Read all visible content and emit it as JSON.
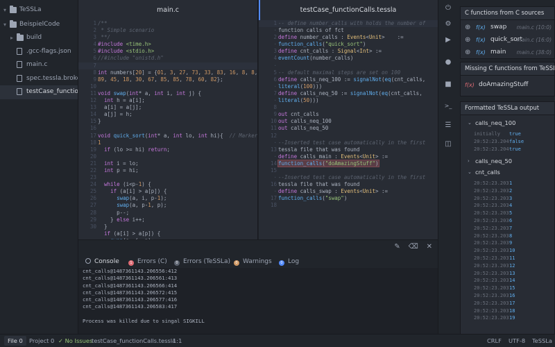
{
  "tree": {
    "root": "TeSSLa",
    "project": "BeispielCode",
    "items": [
      {
        "label": "build",
        "kind": "folder"
      },
      {
        "label": ".gcc-flags.json",
        "kind": "file"
      },
      {
        "label": "main.c",
        "kind": "file"
      },
      {
        "label": "spec.tessla.broken",
        "kind": "file"
      },
      {
        "label": "testCase_functionCalls.tessla",
        "kind": "file",
        "selected": true
      }
    ]
  },
  "editor_left": {
    "tab": "main.c",
    "line_numbers": [
      "1",
      "2",
      "3",
      "4",
      "5",
      "6",
      "7",
      "8",
      "9",
      "10",
      "11",
      "12",
      "13",
      "14",
      "15",
      "16",
      "17",
      "18",
      "19",
      "20",
      "21",
      "22",
      "23",
      "24",
      "25",
      "26",
      "27",
      "28",
      "29",
      "30"
    ],
    "lines": [
      "/**",
      " * Simple scenario",
      " **/",
      "#include <time.h>",
      "#include <stdio.h>",
      "//#include \"unistd.h\"",
      "",
      "int numbers[20] = {01, 3, 27, 73, 33, 83, 16, 8, 8,",
      "89, 45, 18, 30, 67, 85, 85, 78, 60, 82};",
      "",
      "void swap(int* a, int i, int j) {",
      "  int h = a[i];",
      "  a[i] = a[j];",
      "  a[j] = h;",
      "}",
      "",
      "void quick_sort(int* a, int lo, int hi){  // Marker",
      "1",
      "  if (lo >= hi) return;",
      "",
      "  int i = lo;",
      "  int p = hi;",
      "",
      "  while (i<p-1) {",
      "    if (a[i] > a[p]) {",
      "      swap(a, i, p-1);",
      "      swap(a, p-1, p);",
      "      p--;",
      "    } else i++;",
      "  }",
      "  if (a[i] > a[p]) {",
      "    swap(a, i, p);"
    ]
  },
  "editor_right": {
    "tab": "testCase_functionCalls.tessla",
    "line_numbers": [
      "1",
      "·",
      "2",
      "·",
      "3",
      "4",
      "·",
      "5",
      "6",
      "·",
      "7",
      "·",
      "8",
      "9",
      "10",
      "11",
      "12",
      "·",
      "13",
      "·",
      "14",
      "15",
      "·",
      "16",
      "·",
      "17",
      "18"
    ],
    "lines": [
      "-- define number_calls with holds the number of",
      "function calls of fct",
      "define number_calls : Events<Unit>    :=",
      "function_calls(\"quick_sort\")",
      "define cnt_calls : Signal<Int> :=",
      "eventCount(number_calls)",
      "",
      "-- default maximal steps are set on 100",
      "define calls_neq_100 := signalNot(eq(cnt_calls,",
      "literal(100)))",
      "define calls_neq_50 := signalNot(eq(cnt_calls,",
      "literal(50)))",
      "",
      "out cnt_calls",
      "out calls_neq_100",
      "out calls_neq_50",
      "",
      "--Inserted test case automatically in the first",
      "tessla file that was found",
      "define calls_main : Events<Unit> :=",
      "function_calls(\"doAmazingStuff\")",
      "",
      "--Inserted test case automatically in the first",
      "tessla file that was found",
      "define calls_swap : Events<Unit> :=",
      "function_calls(\"swap\")",
      ""
    ]
  },
  "console": {
    "tabs": [
      {
        "label": "Console",
        "badge": ""
      },
      {
        "label": "Errors (C)",
        "badge": "1"
      },
      {
        "label": "Errors (TeSSLa)",
        "badge": "0"
      },
      {
        "label": "Warnings",
        "badge": "0"
      },
      {
        "label": "Log",
        "badge": "0"
      }
    ],
    "output": "cnt_calls@1487361143.206556:412\ncnt_calls@1487361143.206561:413\ncnt_calls@1487361143.206566:414\ncnt_calls@1487361143.206572:415\ncnt_calls@1487361143.206577:416\ncnt_calls@1487361143.206583:417\n\nProcess was killed due to singal SIGKILL"
  },
  "right_panel": {
    "c_functions": {
      "title": "C functions from C sources",
      "items": [
        {
          "fx": "f(x)",
          "name": "swap",
          "loc": "main.c (10:0)"
        },
        {
          "fx": "f(x)",
          "name": "quick_sort",
          "loc": "main.c (16:0)"
        },
        {
          "fx": "f(x)",
          "name": "main",
          "loc": "main.c (38:0)"
        }
      ]
    },
    "missing": {
      "title": "Missing C functions from TeSSLa",
      "items": [
        {
          "fx": "f(x)",
          "name": "doAmazingStuff"
        }
      ]
    },
    "formatted": {
      "title": "Formatted TeSSLa output",
      "groups": [
        {
          "name": "calls_neq_100",
          "rows": [
            {
              "ts": "initially",
              "val": "true"
            },
            {
              "ts": "20:52:23.204",
              "val": "false"
            },
            {
              "ts": "20:52:23.204",
              "val": "true"
            }
          ]
        },
        {
          "name": "calls_neq_50",
          "rows": []
        },
        {
          "name": "cnt_calls",
          "rows": [
            {
              "ts": "20:52:23.203",
              "val": "1"
            },
            {
              "ts": "20:52:23.203",
              "val": "2"
            },
            {
              "ts": "20:52:23.203",
              "val": "3"
            },
            {
              "ts": "20:52:23.203",
              "val": "4"
            },
            {
              "ts": "20:52:23.203",
              "val": "5"
            },
            {
              "ts": "20:52:23.203",
              "val": "6"
            },
            {
              "ts": "20:52:23.203",
              "val": "7"
            },
            {
              "ts": "20:52:23.203",
              "val": "8"
            },
            {
              "ts": "20:52:23.203",
              "val": "9"
            },
            {
              "ts": "20:52:23.203",
              "val": "10"
            },
            {
              "ts": "20:52:23.203",
              "val": "11"
            },
            {
              "ts": "20:52:23.203",
              "val": "12"
            },
            {
              "ts": "20:52:23.203",
              "val": "13"
            },
            {
              "ts": "20:52:23.203",
              "val": "14"
            },
            {
              "ts": "20:52:23.203",
              "val": "15"
            },
            {
              "ts": "20:52:23.203",
              "val": "16"
            },
            {
              "ts": "20:52:23.203",
              "val": "17"
            },
            {
              "ts": "20:52:23.203",
              "val": "18"
            },
            {
              "ts": "20:52:23.203",
              "val": "19"
            }
          ]
        }
      ]
    }
  },
  "status": {
    "file_tab": "File",
    "file_count": "0",
    "project_tab": "Project",
    "project_count": "0",
    "issues": "No Issues",
    "current_file": "testCase_functionCalls.tessla",
    "cursor": "1:1",
    "line_ending": "CRLF",
    "encoding": "UTF-8",
    "grammar": "TeSSLa"
  },
  "icons": [
    "chevron-down-icon",
    "folder-icon",
    "file-icon",
    "play-icon",
    "gear-icon",
    "stop-icon",
    "record-icon",
    "terminal-icon",
    "list-icon",
    "layout-icon",
    "edit-icon",
    "trash-icon",
    "close-icon",
    "plus-icon",
    "check-icon"
  ],
  "colors": {
    "accent": "#528bff",
    "keyword": "#c678dd",
    "function": "#61afef",
    "string": "#98c379",
    "number": "#d19a66",
    "error": "#e06c75"
  }
}
